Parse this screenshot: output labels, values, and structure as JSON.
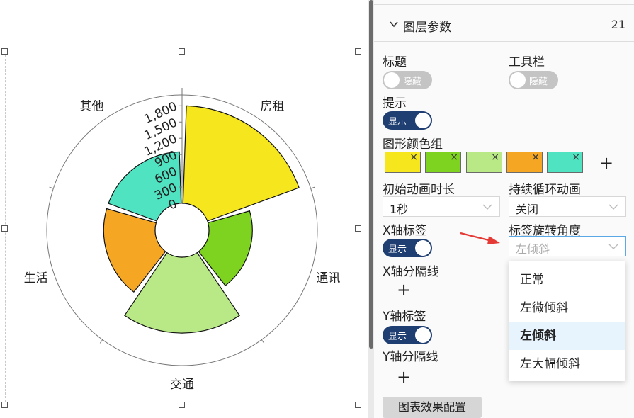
{
  "chart_data": {
    "type": "polar-bar",
    "categories": [
      "房租",
      "通讯",
      "交通",
      "生活",
      "其他"
    ],
    "values": [
      1800,
      800,
      1400,
      950,
      950
    ],
    "colors": [
      "#f5e61e",
      "#7ed321",
      "#b8e986",
      "#f5a623",
      "#50e3c2"
    ],
    "radial_ticks": [
      "0",
      "300",
      "600",
      "900",
      "1,200",
      "1,500",
      "1,800"
    ],
    "rmax": 2000
  },
  "panel": {
    "header": {
      "title": "图层参数",
      "count": "21"
    },
    "title_label": "标题",
    "title_switch": "隐藏",
    "toolbar_label": "工具栏",
    "toolbar_switch": "隐藏",
    "tooltip_label": "提示",
    "tooltip_switch": "显示",
    "colors_label": "图形颜色组",
    "swatches": [
      "#f5e61e",
      "#7ed321",
      "#b8e986",
      "#f5a623",
      "#50e3c2"
    ],
    "swatch_remove": "×",
    "add": "+",
    "anim_label": "初始动画时长",
    "anim_value": "1秒",
    "loop_label": "持续循环动画",
    "loop_value": "关闭",
    "xlabel_label": "X轴标签",
    "xlabel_switch": "显示",
    "rotate_label": "标签旋转角度",
    "rotate_value": "左倾斜",
    "xsplit_label": "X轴分隔线",
    "ylabel_label": "Y轴标签",
    "ylabel_switch": "显示",
    "ysplit_label": "Y轴分隔线",
    "dropdown_options": [
      "正常",
      "左微倾斜",
      "左倾斜",
      "左大幅倾斜"
    ],
    "effect_button": "图表效果配置"
  },
  "accent": "#1f3f73",
  "annotation_color": "#e53935"
}
